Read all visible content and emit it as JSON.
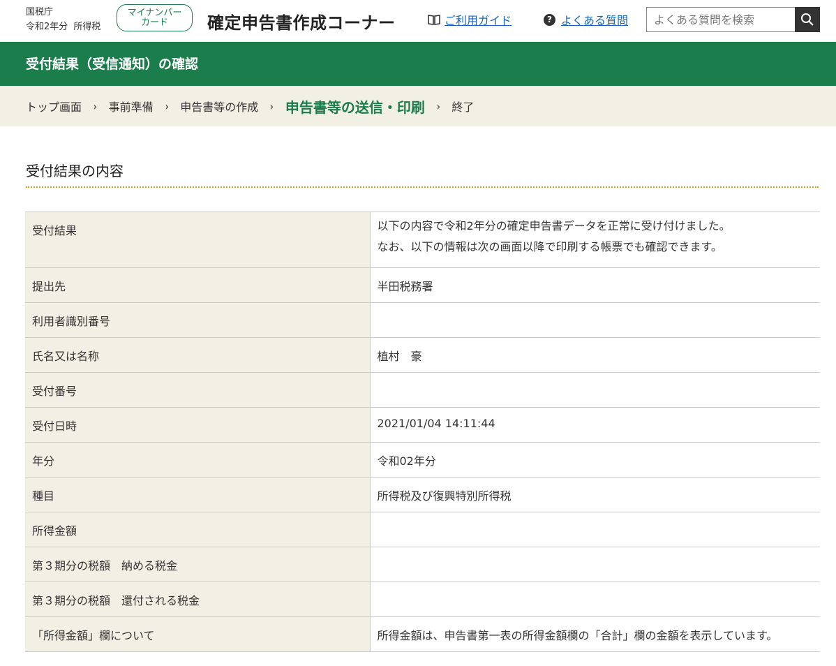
{
  "header": {
    "agency": "国税庁",
    "year_label": "令和2年分",
    "tax_label": "所得税",
    "mynumber_badge_line1": "マイナンバー",
    "mynumber_badge_line2": "カード",
    "site_title": "確定申告書作成コーナー",
    "guide_link": "ご利用ガイド",
    "faq_link": "よくある質問",
    "search_placeholder": "よくある質問を検索",
    "search_icon": "search-icon",
    "guide_icon": "book-icon",
    "faq_icon": "question-circle-icon"
  },
  "page_title": "受付結果（受信通知）の確認",
  "breadcrumb": {
    "items": [
      "トップ画面",
      "事前準備",
      "申告書等の作成",
      "申告書等の送信・印刷",
      "終了"
    ],
    "current_index": 3,
    "separator": "›"
  },
  "section_title": "受付結果の内容",
  "rows": [
    {
      "label": "受付結果",
      "value_line1": "以下の内容で令和2年分の確定申告書データを正常に受け付けました。",
      "value_line2": "なお、以下の情報は次の画面以降で印刷する帳票でも確認できます。"
    },
    {
      "label": "提出先",
      "value": "半田税務署"
    },
    {
      "label": "利用者識別番号",
      "value": ""
    },
    {
      "label": "氏名又は名称",
      "value": "植村　豪"
    },
    {
      "label": "受付番号",
      "value": ""
    },
    {
      "label": "受付日時",
      "value": "2021/01/04 14:11:44"
    },
    {
      "label": "年分",
      "value": "令和02年分"
    },
    {
      "label": "種目",
      "value": "所得税及び復興特別所得税"
    },
    {
      "label": "所得金額",
      "value": ""
    },
    {
      "label": "第３期分の税額　納める税金",
      "value": ""
    },
    {
      "label": "第３期分の税額　還付される税金",
      "value": ""
    },
    {
      "label": "「所得金額」欄について",
      "value": "所得金額は、申告書第一表の所得金額欄の「合計」欄の金額を表示しています。"
    }
  ],
  "colors": {
    "brand_green": "#1b7d4b",
    "label_bg": "#f2efe4",
    "link_blue": "#1565c0",
    "divider_gold": "#d4a017"
  }
}
